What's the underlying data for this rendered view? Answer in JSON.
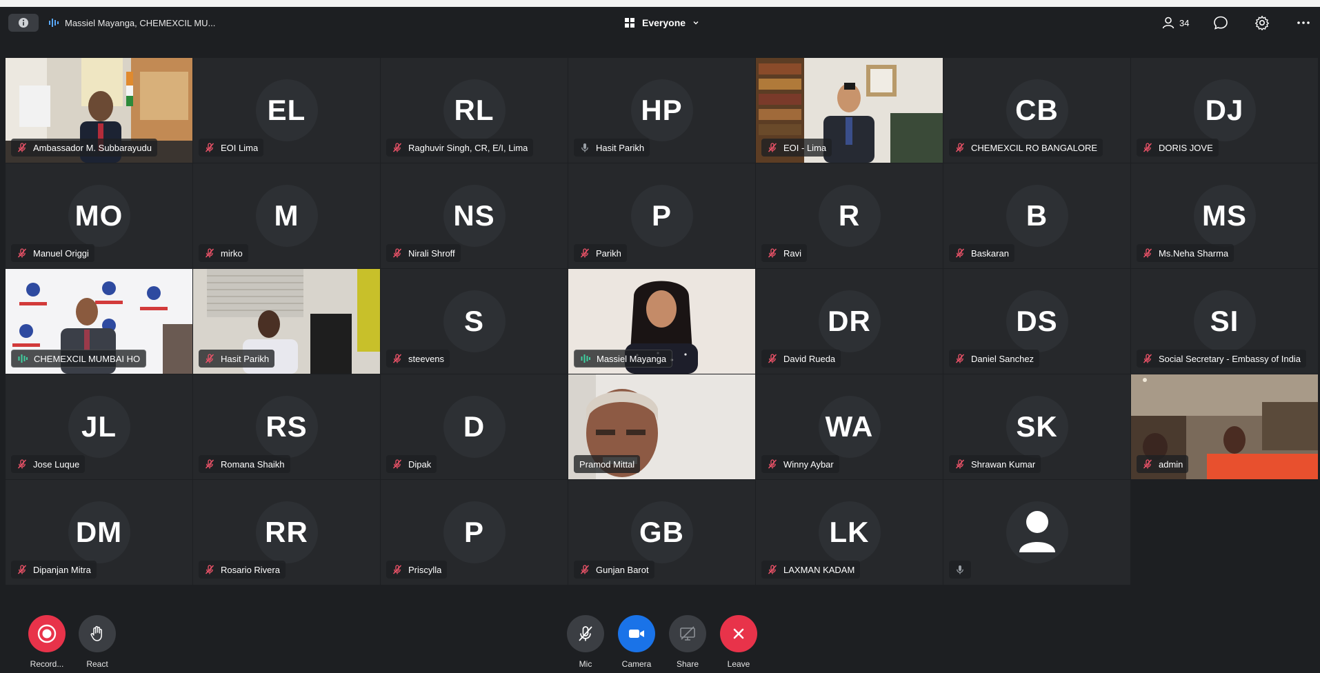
{
  "topbar": {
    "speakers_text": "Massiel Mayanga, CHEMEXCIL MU...",
    "view_label": "Everyone",
    "participants_count": "34"
  },
  "colors": {
    "record": "#e8334a",
    "leave": "#e8334a",
    "camera": "#1a73e8",
    "muted_icon": "#f2546a",
    "speaking": "#3fd0a0"
  },
  "tiles": [
    {
      "name": "Ambassador M. Subbarayudu",
      "initials": "",
      "mic": "muted",
      "video": "room-flags"
    },
    {
      "name": "EOI Lima",
      "initials": "EL",
      "mic": "muted",
      "video": ""
    },
    {
      "name": "Raghuvir Singh, CR, E/I, Lima",
      "initials": "RL",
      "mic": "muted",
      "video": ""
    },
    {
      "name": "Hasit Parikh",
      "initials": "HP",
      "mic": "on",
      "video": ""
    },
    {
      "name": "EOI - Lima",
      "initials": "",
      "mic": "muted",
      "video": "office-bookshelf"
    },
    {
      "name": "CHEMEXCIL RO BANGALORE",
      "initials": "CB",
      "mic": "muted",
      "video": ""
    },
    {
      "name": "DORIS JOVE",
      "initials": "DJ",
      "mic": "muted",
      "video": ""
    },
    {
      "name": "Manuel Origgi",
      "initials": "MO",
      "mic": "muted",
      "video": ""
    },
    {
      "name": "mirko",
      "initials": "M",
      "mic": "muted",
      "video": ""
    },
    {
      "name": "Nirali Shroff",
      "initials": "NS",
      "mic": "muted",
      "video": ""
    },
    {
      "name": "Parikh",
      "initials": "P",
      "mic": "muted",
      "video": ""
    },
    {
      "name": "Ravi",
      "initials": "R",
      "mic": "muted",
      "video": ""
    },
    {
      "name": "Baskaran",
      "initials": "B",
      "mic": "muted",
      "video": ""
    },
    {
      "name": "Ms.Neha Sharma",
      "initials": "MS",
      "mic": "muted",
      "video": ""
    },
    {
      "name": "CHEMEXCIL MUMBAI HO",
      "initials": "",
      "mic": "speaking",
      "video": "logo-backdrop"
    },
    {
      "name": "Hasit Parikh",
      "initials": "",
      "mic": "muted",
      "video": "office-desk"
    },
    {
      "name": "steevens",
      "initials": "S",
      "mic": "muted",
      "video": ""
    },
    {
      "name": "Massiel Mayanga",
      "initials": "",
      "mic": "speaking",
      "video": "woman-plain-wall"
    },
    {
      "name": "David Rueda",
      "initials": "DR",
      "mic": "muted",
      "video": ""
    },
    {
      "name": "Daniel Sanchez",
      "initials": "DS",
      "mic": "muted",
      "video": ""
    },
    {
      "name": "Social Secretary - Embassy of India",
      "initials": "SI",
      "mic": "muted",
      "video": ""
    },
    {
      "name": "Jose Luque",
      "initials": "JL",
      "mic": "muted",
      "video": ""
    },
    {
      "name": "Romana Shaikh",
      "initials": "RS",
      "mic": "muted",
      "video": ""
    },
    {
      "name": "Dipak",
      "initials": "D",
      "mic": "muted",
      "video": ""
    },
    {
      "name": "Pramod Mittal",
      "initials": "",
      "mic": "none",
      "video": "man-close-up"
    },
    {
      "name": "Winny Aybar",
      "initials": "WA",
      "mic": "muted",
      "video": ""
    },
    {
      "name": "Shrawan Kumar",
      "initials": "SK",
      "mic": "muted",
      "video": ""
    },
    {
      "name": "admin",
      "initials": "",
      "mic": "muted",
      "video": "dim-room"
    },
    {
      "name": "Dipanjan Mitra",
      "initials": "DM",
      "mic": "muted",
      "video": ""
    },
    {
      "name": "Rosario Rivera",
      "initials": "RR",
      "mic": "muted",
      "video": ""
    },
    {
      "name": "Priscylla",
      "initials": "P",
      "mic": "muted",
      "video": ""
    },
    {
      "name": "Gunjan Barot",
      "initials": "GB",
      "mic": "muted",
      "video": ""
    },
    {
      "name": "LAXMAN KADAM",
      "initials": "LK",
      "mic": "muted",
      "video": ""
    },
    {
      "name": "",
      "initials": "",
      "mic": "on",
      "video": "",
      "avatar": "person-icon"
    }
  ],
  "controls": {
    "record_label": "Record...",
    "react_label": "React",
    "mic_label": "Mic",
    "camera_label": "Camera",
    "share_label": "Share",
    "leave_label": "Leave"
  }
}
